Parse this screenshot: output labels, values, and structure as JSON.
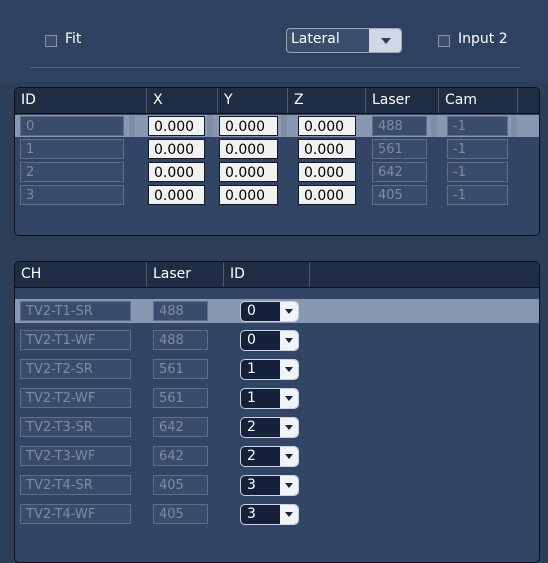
{
  "top": {
    "fit_label": "Fit",
    "mode_value": "Lateral",
    "input2_label": "Input 2"
  },
  "table1": {
    "headers": [
      "ID",
      "X",
      "Y",
      "Z",
      "Laser",
      "Cam"
    ],
    "rows": [
      {
        "id": "0",
        "x": "0.000",
        "y": "0.000",
        "z": "0.000",
        "laser": "488",
        "cam": "-1"
      },
      {
        "id": "1",
        "x": "0.000",
        "y": "0.000",
        "z": "0.000",
        "laser": "561",
        "cam": "-1"
      },
      {
        "id": "2",
        "x": "0.000",
        "y": "0.000",
        "z": "0.000",
        "laser": "642",
        "cam": "-1"
      },
      {
        "id": "3",
        "x": "0.000",
        "y": "0.000",
        "z": "0.000",
        "laser": "405",
        "cam": "-1"
      }
    ]
  },
  "table2": {
    "headers": [
      "CH",
      "Laser",
      "ID"
    ],
    "rows": [
      {
        "ch": "TV2-T1-SR",
        "laser": "488",
        "id": "0"
      },
      {
        "ch": "TV2-T1-WF",
        "laser": "488",
        "id": "0"
      },
      {
        "ch": "TV2-T2-SR",
        "laser": "561",
        "id": "1"
      },
      {
        "ch": "TV2-T2-WF",
        "laser": "561",
        "id": "1"
      },
      {
        "ch": "TV2-T3-SR",
        "laser": "642",
        "id": "2"
      },
      {
        "ch": "TV2-T3-WF",
        "laser": "642",
        "id": "2"
      },
      {
        "ch": "TV2-T4-SR",
        "laser": "405",
        "id": "3"
      },
      {
        "ch": "TV2-T4-WF",
        "laser": "405",
        "id": "3"
      }
    ]
  }
}
